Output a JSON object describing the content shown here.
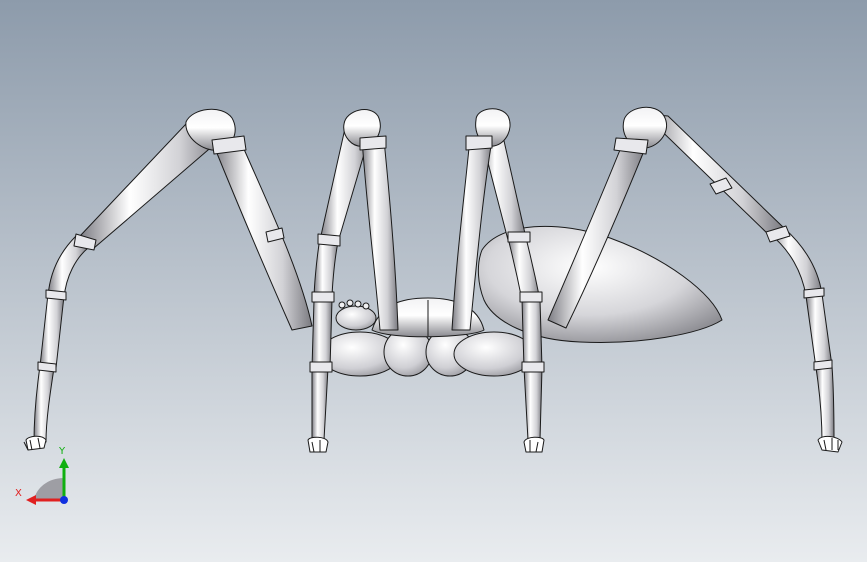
{
  "viewport": {
    "background_top": "#8d9bab",
    "background_bottom": "#e9ecef"
  },
  "model": {
    "icon": "spider-model-icon",
    "legs": [
      {
        "name": "leg-left-outer"
      },
      {
        "name": "leg-left-inner"
      },
      {
        "name": "leg-right-inner"
      },
      {
        "name": "leg-right-outer"
      }
    ]
  },
  "triad": {
    "icon": "coordinate-triad-icon",
    "x_label": "X",
    "y_label": "Y",
    "x_color": "#e02020",
    "y_color": "#10b010",
    "z_color": "#1030e0"
  }
}
